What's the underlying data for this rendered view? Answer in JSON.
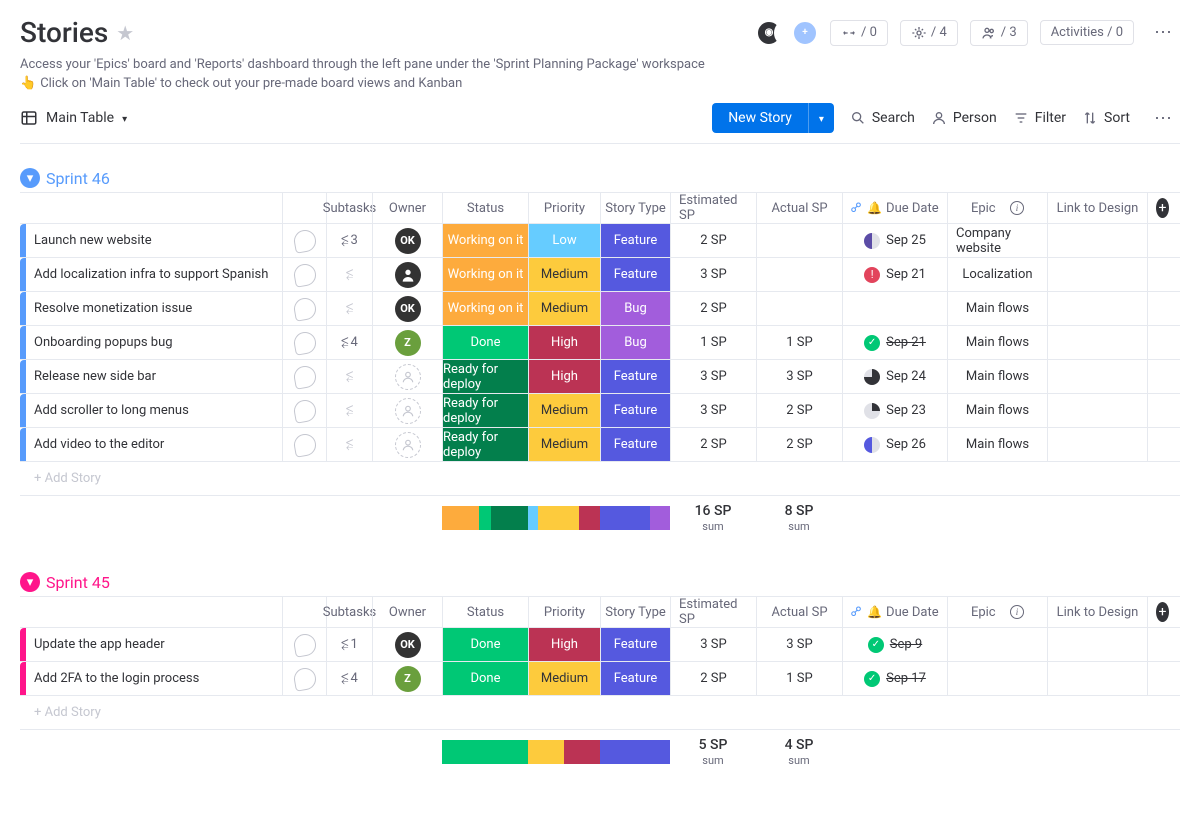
{
  "page": {
    "title": "Stories",
    "subtitle1": "Access your 'Epics' board and 'Reports' dashboard through the left pane under the 'Sprint Planning Package' workspace",
    "subtitle2": "Click on 'Main Table' to check out your pre-made board views and Kanban",
    "pointer_emoji": "👆"
  },
  "header_pills": {
    "integrate": "/ 0",
    "automate": "/ 4",
    "members": "/ 3",
    "activities": "Activities / 0"
  },
  "toolbar": {
    "main_table": "Main Table",
    "new_story": "New Story",
    "search": "Search",
    "person": "Person",
    "filter": "Filter",
    "sort": "Sort"
  },
  "columns": {
    "subtasks": "Subtasks",
    "owner": "Owner",
    "status": "Status",
    "priority": "Priority",
    "story_type": "Story Type",
    "est_sp": "Estimated SP",
    "act_sp": "Actual SP",
    "due": "Due Date",
    "epic": "Epic",
    "link": "Link to Design"
  },
  "groups": [
    {
      "name": "Sprint 46",
      "color_class": "g-blue",
      "rows": [
        {
          "name": "Launch new website",
          "sub": "3",
          "owner": "OK",
          "owner_class": "av-ok",
          "status": "Working on it",
          "status_class": "st-working",
          "priority": "Low",
          "priority_class": "pr-low",
          "type": "Feature",
          "type_class": "ty-feature",
          "est": "2 SP",
          "act": "",
          "due": "Sep 25",
          "due_ind": "ind-half",
          "epic": "Company website"
        },
        {
          "name": "Add localization infra to support Spanish",
          "sub": "",
          "owner": "",
          "owner_class": "av-person",
          "owner_icon": "person",
          "status": "Working on it",
          "status_class": "st-working",
          "priority": "Medium",
          "priority_class": "pr-med",
          "type": "Feature",
          "type_class": "ty-feature",
          "est": "3 SP",
          "act": "",
          "due": "Sep 21",
          "due_ind": "ind-alert",
          "due_ind_text": "!",
          "epic": "Localization"
        },
        {
          "name": "Resolve monetization issue",
          "sub": "",
          "owner": "OK",
          "owner_class": "av-ok",
          "status": "Working on it",
          "status_class": "st-working",
          "priority": "Medium",
          "priority_class": "pr-med",
          "type": "Bug",
          "type_class": "ty-bug",
          "est": "2 SP",
          "act": "",
          "due": "",
          "due_ind": "",
          "epic": "Main flows"
        },
        {
          "name": "Onboarding popups bug",
          "sub": "4",
          "owner": "Z",
          "owner_class": "av-z",
          "status": "Done",
          "status_class": "st-done",
          "priority": "High",
          "priority_class": "pr-high",
          "type": "Bug",
          "type_class": "ty-bug",
          "est": "1 SP",
          "act": "1 SP",
          "due": "Sep 21",
          "due_strike": true,
          "due_ind": "ind-check",
          "due_ind_text": "✓",
          "epic": "Main flows"
        },
        {
          "name": "Release new side bar",
          "sub": "",
          "owner": "",
          "owner_class": "av-empty",
          "status": "Ready for deploy",
          "status_class": "st-ready",
          "priority": "High",
          "priority_class": "pr-high",
          "type": "Feature",
          "type_class": "ty-feature",
          "est": "3 SP",
          "act": "3 SP",
          "due": "Sep 24",
          "due_ind": "ind-q3",
          "epic": "Main flows"
        },
        {
          "name": "Add scroller to long menus",
          "sub": "",
          "owner": "",
          "owner_class": "av-empty",
          "status": "Ready for deploy",
          "status_class": "st-ready",
          "priority": "Medium",
          "priority_class": "pr-med",
          "type": "Feature",
          "type_class": "ty-feature",
          "est": "3 SP",
          "act": "2 SP",
          "due": "Sep 23",
          "due_ind": "ind-q1",
          "epic": "Main flows"
        },
        {
          "name": "Add video to the editor",
          "sub": "",
          "owner": "",
          "owner_class": "av-empty",
          "status": "Ready for deploy",
          "status_class": "st-ready",
          "priority": "Medium",
          "priority_class": "pr-med",
          "type": "Feature",
          "type_class": "ty-feature",
          "est": "2 SP",
          "act": "2 SP",
          "due": "Sep 26",
          "due_ind": "ind-half2",
          "epic": "Main flows"
        }
      ],
      "add_label": "+ Add Story",
      "sum": {
        "est": "16 SP",
        "act": "8 SP",
        "sum_label": "sum",
        "status_bars": [
          [
            "st-working",
            "43"
          ],
          [
            "st-done",
            "14"
          ],
          [
            "st-ready",
            "43"
          ]
        ],
        "priority_bars": [
          [
            "pr-low",
            "14"
          ],
          [
            "pr-med",
            "57"
          ],
          [
            "pr-high",
            "29"
          ]
        ],
        "type_bars": [
          [
            "ty-feature",
            "71"
          ],
          [
            "ty-bug",
            "29"
          ]
        ]
      }
    },
    {
      "name": "Sprint 45",
      "color_class": "g-pink",
      "rows": [
        {
          "name": "Update the app header",
          "sub": "1",
          "owner": "OK",
          "owner_class": "av-ok",
          "status": "Done",
          "status_class": "st-done",
          "priority": "High",
          "priority_class": "pr-high",
          "type": "Feature",
          "type_class": "ty-feature",
          "est": "3 SP",
          "act": "3 SP",
          "due": "Sep 9",
          "due_strike": true,
          "due_ind": "ind-check",
          "due_ind_text": "✓",
          "epic": ""
        },
        {
          "name": "Add 2FA to the login process",
          "sub": "4",
          "owner": "Z",
          "owner_class": "av-z",
          "status": "Done",
          "status_class": "st-done",
          "priority": "Medium",
          "priority_class": "pr-med",
          "type": "Feature",
          "type_class": "ty-feature",
          "est": "2 SP",
          "act": "1 SP",
          "due": "Sep 17",
          "due_strike": true,
          "due_ind": "ind-check",
          "due_ind_text": "✓",
          "epic": ""
        }
      ],
      "add_label": "+ Add Story",
      "sum": {
        "est": "5 SP",
        "act": "4 SP",
        "sum_label": "sum",
        "status_bars": [
          [
            "st-done",
            "100"
          ]
        ],
        "priority_bars": [
          [
            "pr-med",
            "50"
          ],
          [
            "pr-high",
            "50"
          ]
        ],
        "type_bars": [
          [
            "ty-feature",
            "100"
          ]
        ]
      }
    }
  ]
}
